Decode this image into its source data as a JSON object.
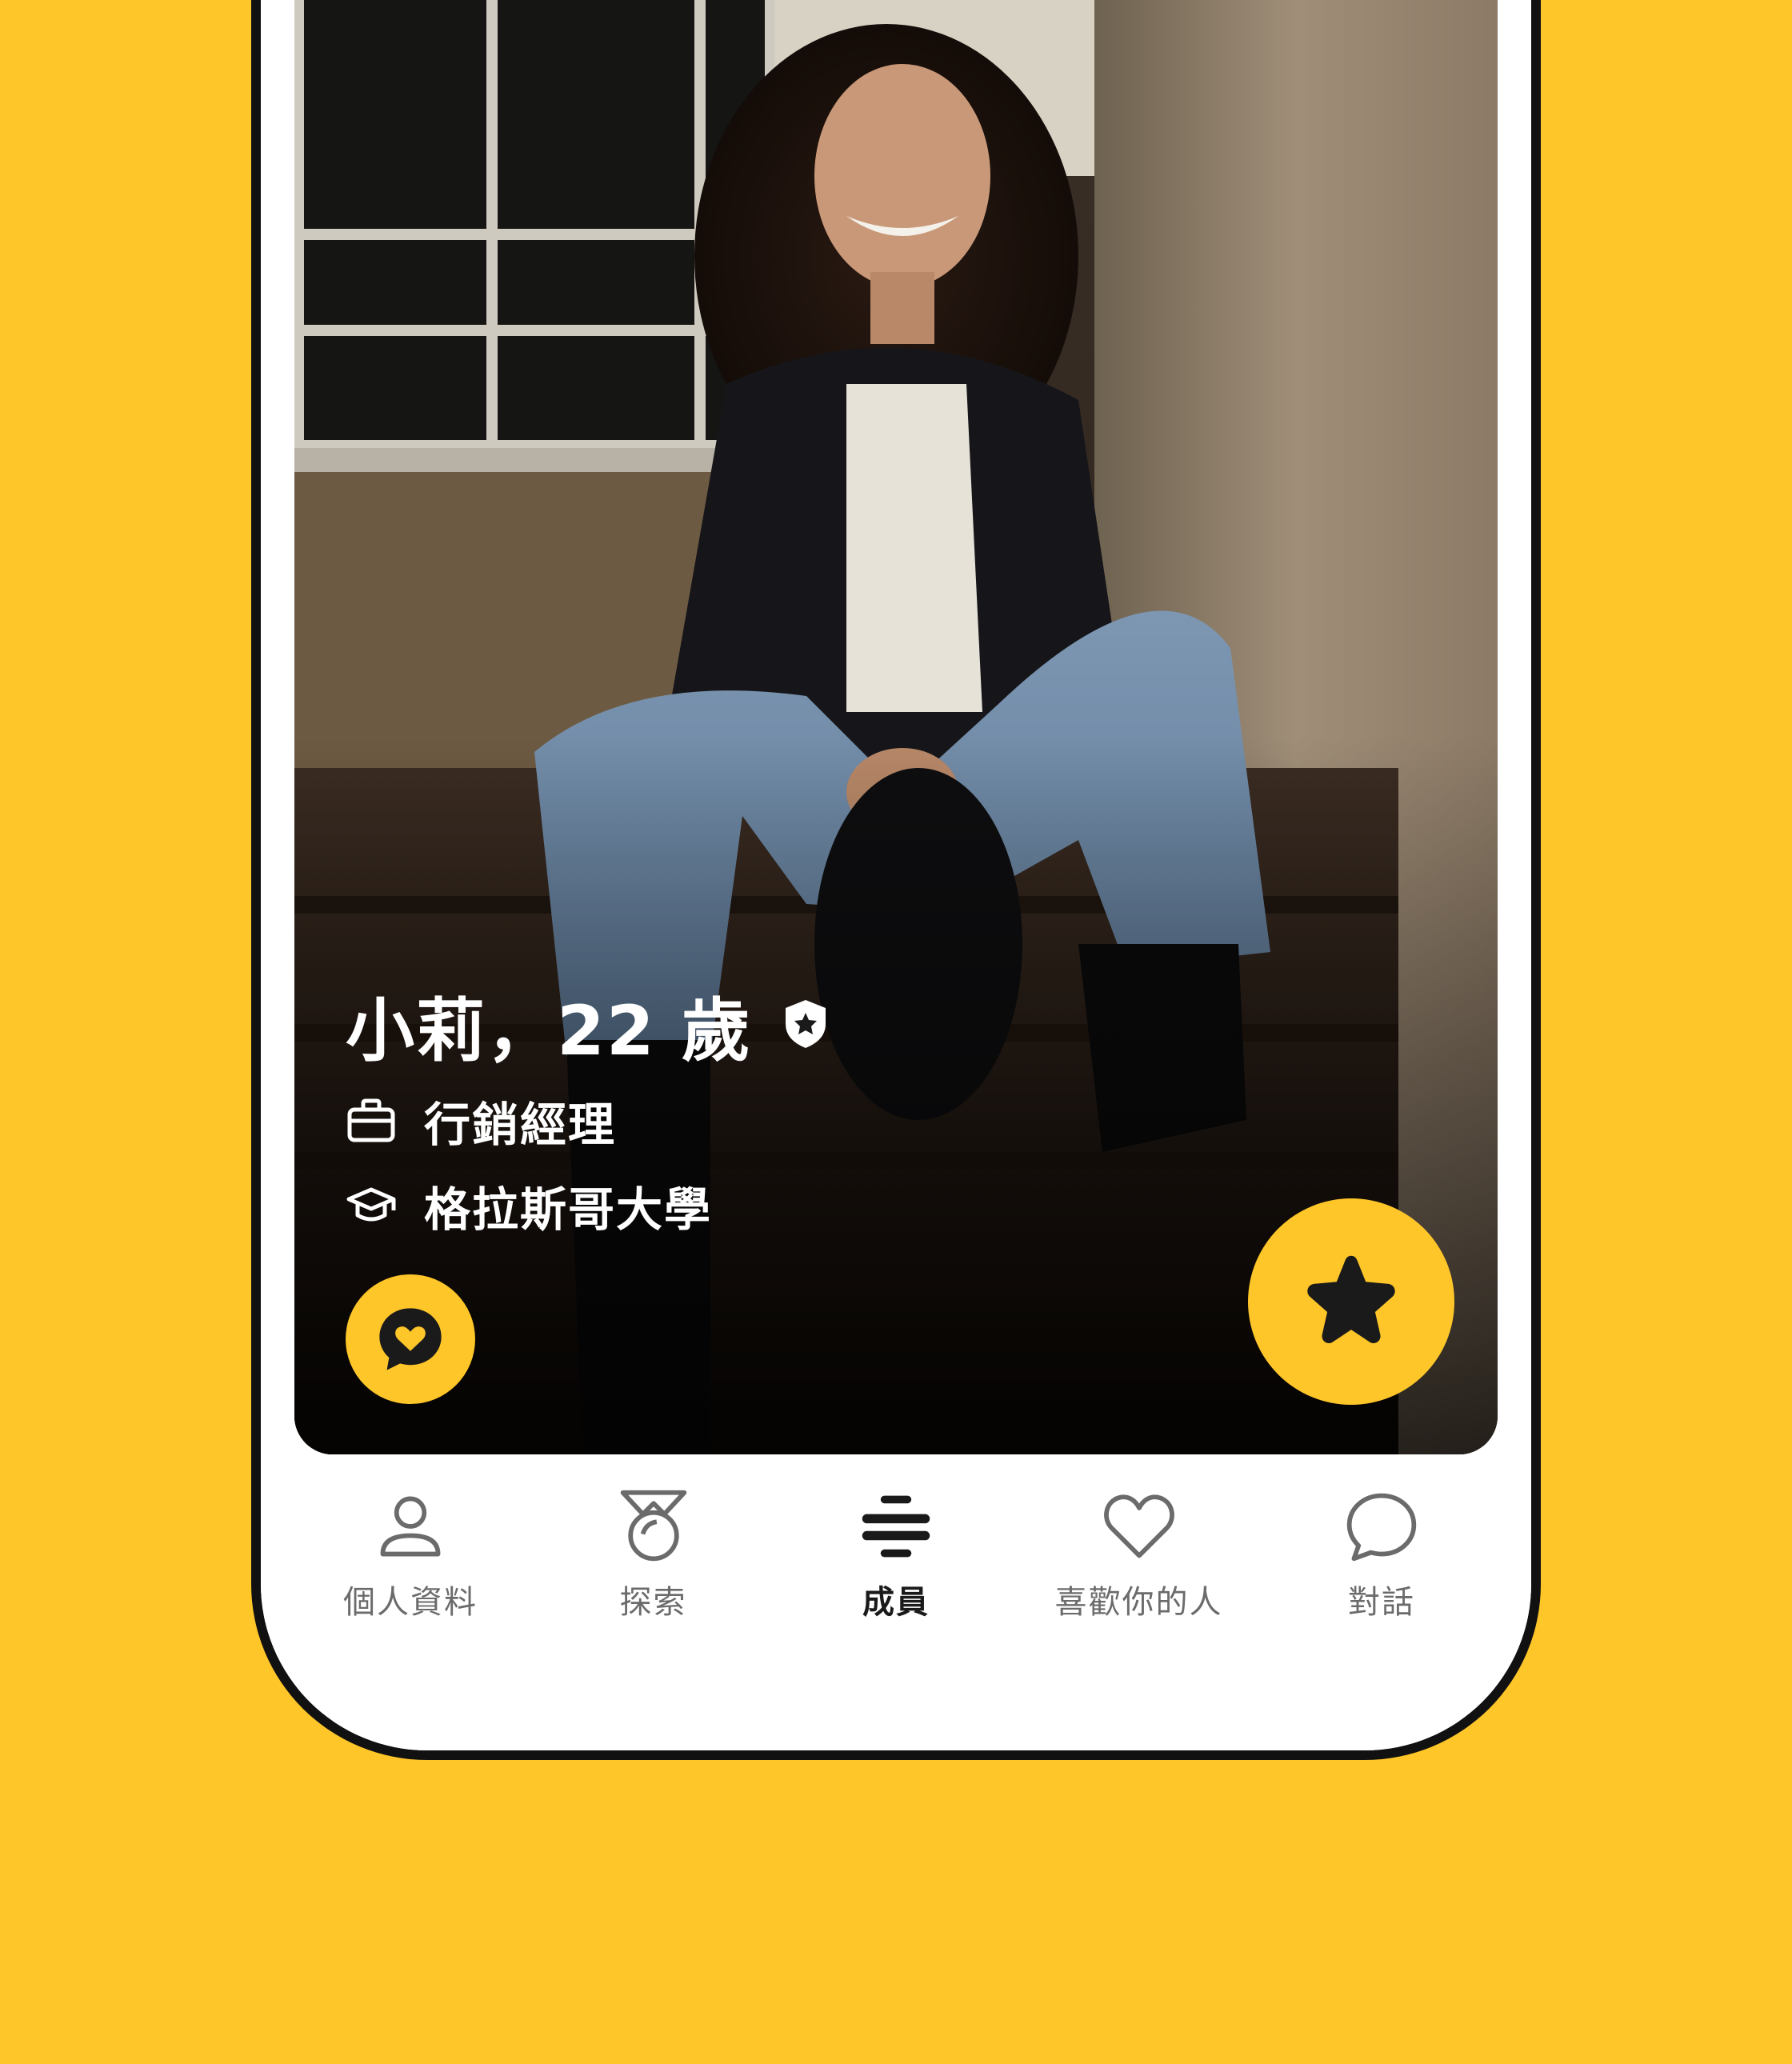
{
  "profile": {
    "name_age": "小莉，22 歲",
    "job": "行銷經理",
    "school": "格拉斯哥大學",
    "verified": true
  },
  "actions": {
    "compliment_icon": "speech-heart-icon",
    "superswipe_icon": "star-icon"
  },
  "tabs": [
    {
      "label": "個人資料",
      "icon": "person-icon",
      "active": false
    },
    {
      "label": "探索",
      "icon": "medal-icon",
      "active": false
    },
    {
      "label": "成員",
      "icon": "bumble-hive-icon",
      "active": true
    },
    {
      "label": "喜歡你的人",
      "icon": "heart-icon",
      "active": false
    },
    {
      "label": "對話",
      "icon": "chat-bubble-icon",
      "active": false
    }
  ],
  "colors": {
    "brand_yellow": "#FFC629",
    "text_dark": "#1a1a1a",
    "text_muted": "#6b6b6b",
    "frame": "#111111"
  }
}
